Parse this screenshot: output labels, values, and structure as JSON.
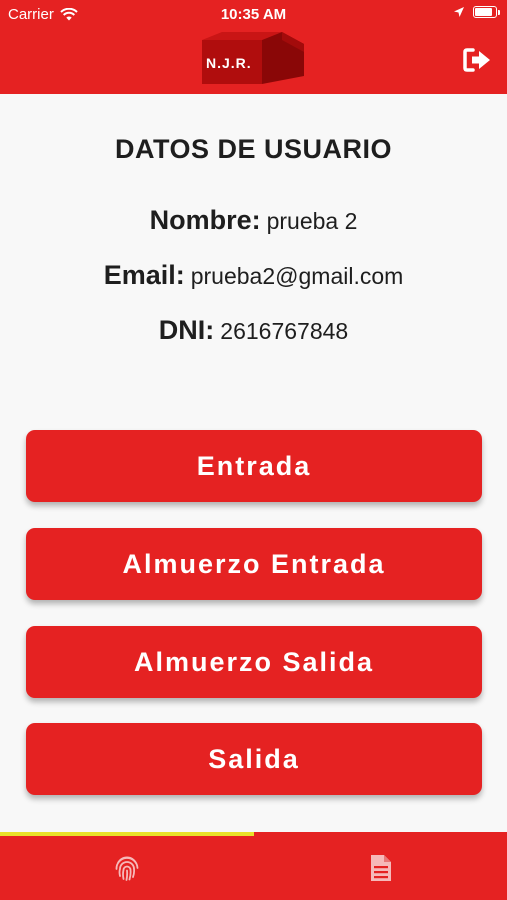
{
  "status_bar": {
    "carrier": "Carrier",
    "time": "10:35 AM",
    "battery_level": 0.9
  },
  "header": {
    "logo_text": "N.J.R.",
    "logout_icon": "sign-out-icon"
  },
  "user_data": {
    "title": "DATOS DE USUARIO",
    "name_label": "Nombre:",
    "name_value": "prueba 2",
    "email_label": "Email:",
    "email_value": "prueba2@gmail.com",
    "dni_label": "DNI:",
    "dni_value": "2616767848"
  },
  "actions": {
    "entrada": "Entrada",
    "almuerzo_entrada": "Almuerzo Entrada",
    "almuerzo_salida": "Almuerzo Salida",
    "salida": "Salida"
  },
  "tabbar": {
    "tabs": [
      {
        "icon": "fingerprint-icon",
        "active": true
      },
      {
        "icon": "document-icon",
        "active": false
      }
    ]
  },
  "colors": {
    "brand_red": "#e52222",
    "tab_indicator": "#e9e12a",
    "background": "#f8f8f8"
  }
}
